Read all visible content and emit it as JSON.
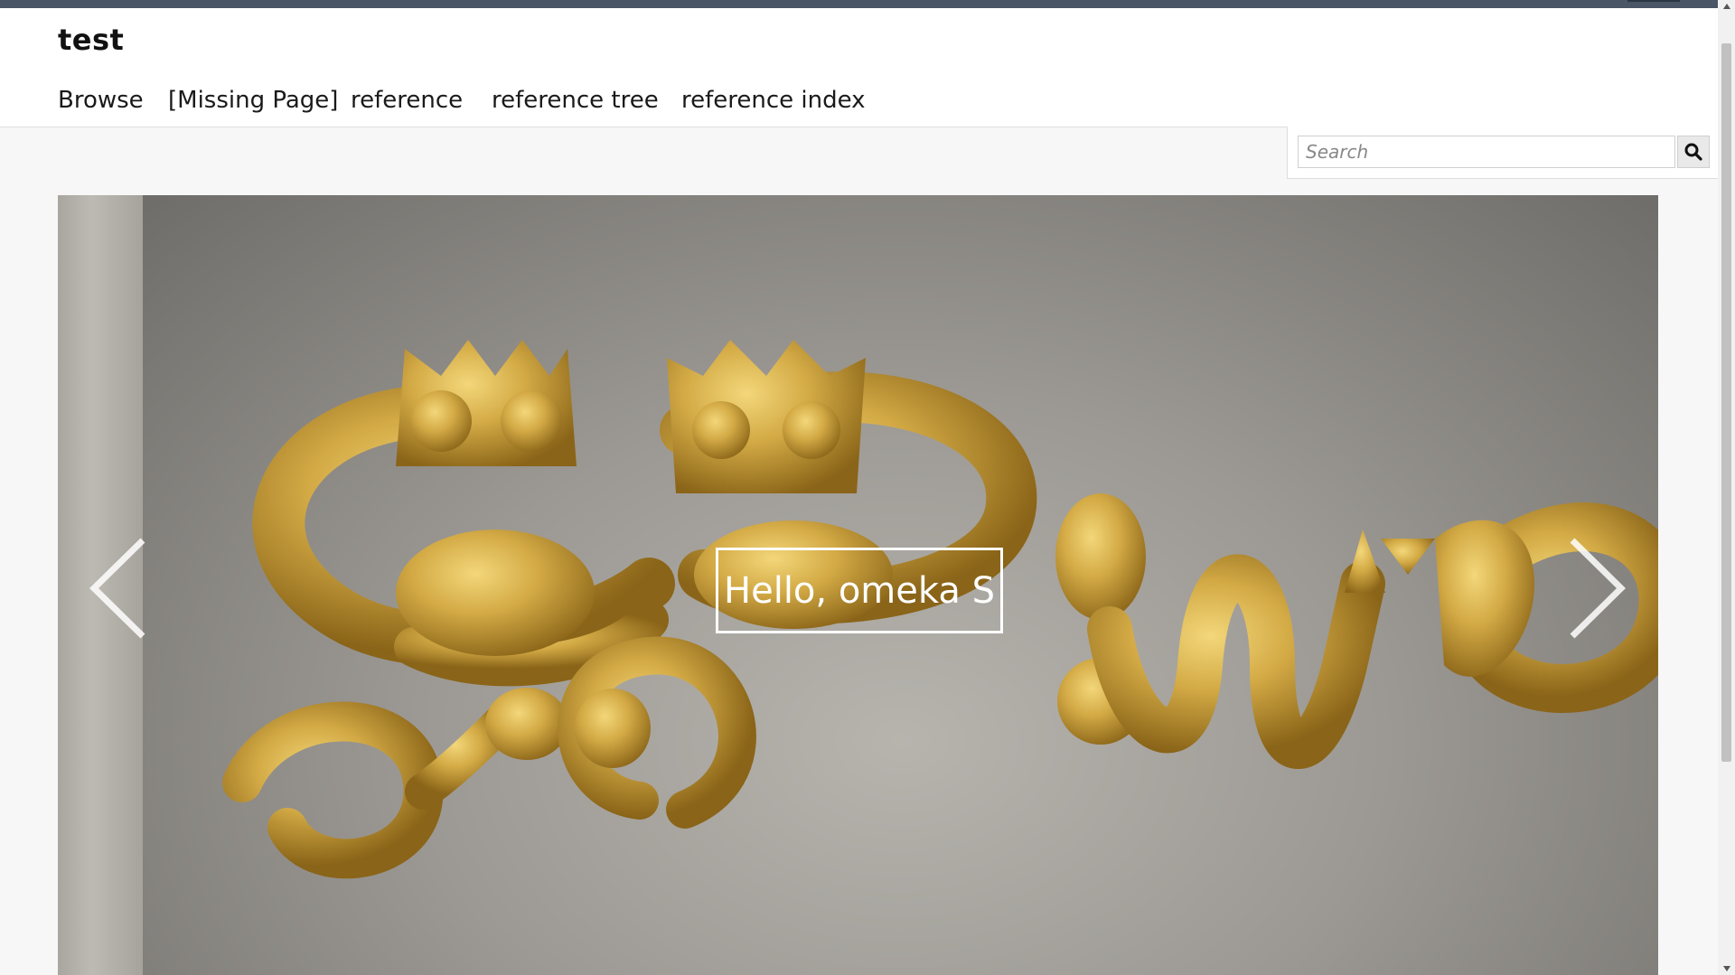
{
  "site": {
    "title": "test"
  },
  "nav": {
    "items": [
      {
        "label": "Browse"
      },
      {
        "label": "[Missing Page]"
      },
      {
        "label": "reference"
      },
      {
        "label": "reference tree"
      },
      {
        "label": "reference index"
      }
    ]
  },
  "search": {
    "placeholder": "Search",
    "button_icon": "search-icon"
  },
  "slider": {
    "caption": "Hello, omeka S",
    "image_subject": "gold spiral ornaments with lion and griffin heads",
    "prev_icon": "chevron-left-icon",
    "next_icon": "chevron-right-icon"
  },
  "colors": {
    "topbar": "#4a5566",
    "header_bg": "#ffffff",
    "page_bg": "#f7f7f7",
    "gold": "#c9a23c"
  }
}
